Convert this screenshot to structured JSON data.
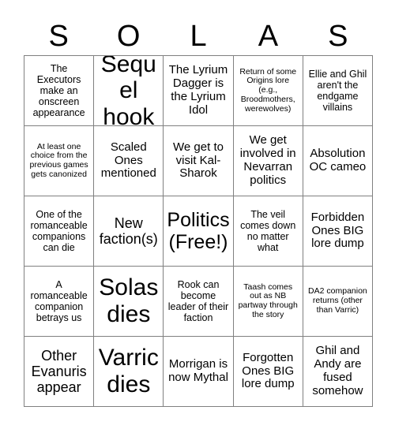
{
  "header": {
    "letters": [
      "S",
      "O",
      "L",
      "A",
      "S"
    ]
  },
  "colors": {
    "background": "#ffffff",
    "text": "#000000",
    "grid_line": "#808080"
  },
  "grid": {
    "columns": 5,
    "rows": 5,
    "cells": [
      [
        {
          "text": "The Executors make an onscreen appearance",
          "size": "sm"
        },
        {
          "text": "Sequel hook",
          "size": "xxl"
        },
        {
          "text": "The Lyrium Dagger is the Lyrium Idol",
          "size": "md"
        },
        {
          "text": "Return of some Origins lore (e.g., Broodmothers, werewolves)",
          "size": "xs"
        },
        {
          "text": "Ellie and Ghil aren't the endgame villains",
          "size": "sm"
        }
      ],
      [
        {
          "text": "At least one choice from the previous games gets canonized",
          "size": "xs"
        },
        {
          "text": "Scaled Ones mentioned",
          "size": "md"
        },
        {
          "text": "We get to visit Kal-Sharok",
          "size": "md"
        },
        {
          "text": "We get involved in Nevarran politics",
          "size": "md"
        },
        {
          "text": "Absolution OC cameo",
          "size": "md"
        }
      ],
      [
        {
          "text": "One of the romanceable companions can die",
          "size": "sm"
        },
        {
          "text": "New faction(s)",
          "size": "lg"
        },
        {
          "text": "Politics (Free!)",
          "size": "xl"
        },
        {
          "text": "The veil comes down no matter what",
          "size": "sm"
        },
        {
          "text": "Forbidden Ones BIG lore dump",
          "size": "md"
        }
      ],
      [
        {
          "text": "A romanceable companion betrays us",
          "size": "sm"
        },
        {
          "text": "Solas dies",
          "size": "xxl"
        },
        {
          "text": "Rook can become leader of their faction",
          "size": "sm"
        },
        {
          "text": "Taash comes out as NB partway through the story",
          "size": "xs"
        },
        {
          "text": "DA2 companion returns (other than Varric)",
          "size": "xs"
        }
      ],
      [
        {
          "text": "Other Evanuris appear",
          "size": "lg"
        },
        {
          "text": "Varric dies",
          "size": "xxl"
        },
        {
          "text": "Morrigan is now Mythal",
          "size": "md"
        },
        {
          "text": "Forgotten Ones BIG lore dump",
          "size": "md"
        },
        {
          "text": "Ghil and Andy are fused somehow",
          "size": "md"
        }
      ]
    ]
  }
}
